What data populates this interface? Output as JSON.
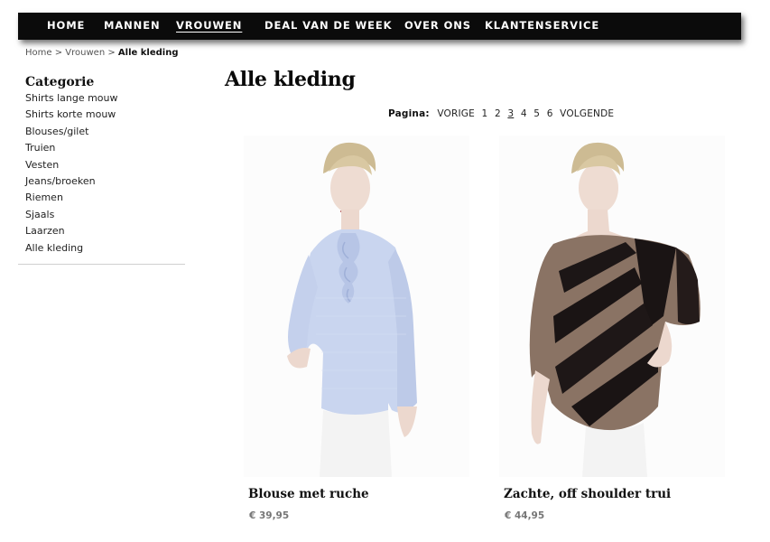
{
  "nav": {
    "items": [
      {
        "label": "HOME"
      },
      {
        "label": "MANNEN"
      },
      {
        "label": "VROUWEN"
      },
      {
        "label": "DEAL VAN DE WEEK"
      },
      {
        "label": "OVER ONS"
      },
      {
        "label": "KLANTENSERVICE"
      }
    ],
    "active": "VROUWEN"
  },
  "breadcrumb": {
    "items": [
      "Home",
      "Vrouwen"
    ],
    "separator": ">",
    "current": "Alle kleding"
  },
  "sidebar": {
    "title": "Categorie",
    "items": [
      {
        "label": "Shirts lange mouw"
      },
      {
        "label": "Shirts korte mouw"
      },
      {
        "label": "Blouses/gilet"
      },
      {
        "label": "Truien"
      },
      {
        "label": "Vesten"
      },
      {
        "label": "Jeans/broeken"
      },
      {
        "label": "Riemen"
      },
      {
        "label": "Sjaals"
      },
      {
        "label": "Laarzen"
      },
      {
        "label": "Alle kleding"
      }
    ]
  },
  "main": {
    "title": "Alle kleding",
    "pagination": {
      "label": "Pagina:",
      "prev": "VORIGE",
      "pages": [
        "1",
        "2",
        "3",
        "4",
        "5",
        "6"
      ],
      "current": "3",
      "next": "VOLGENDE"
    },
    "products": [
      {
        "name": "Blouse met ruche",
        "price": "€ 39,95",
        "image": "model-blue-blouse-photo"
      },
      {
        "name": "Zachte, off shoulder trui",
        "price": "€ 44,95",
        "image": "model-striped-top-photo"
      }
    ]
  },
  "colors": {
    "nav_bg": "#0b0b0b",
    "nav_text": "#ffffff",
    "text": "#222222",
    "price": "#777777"
  }
}
